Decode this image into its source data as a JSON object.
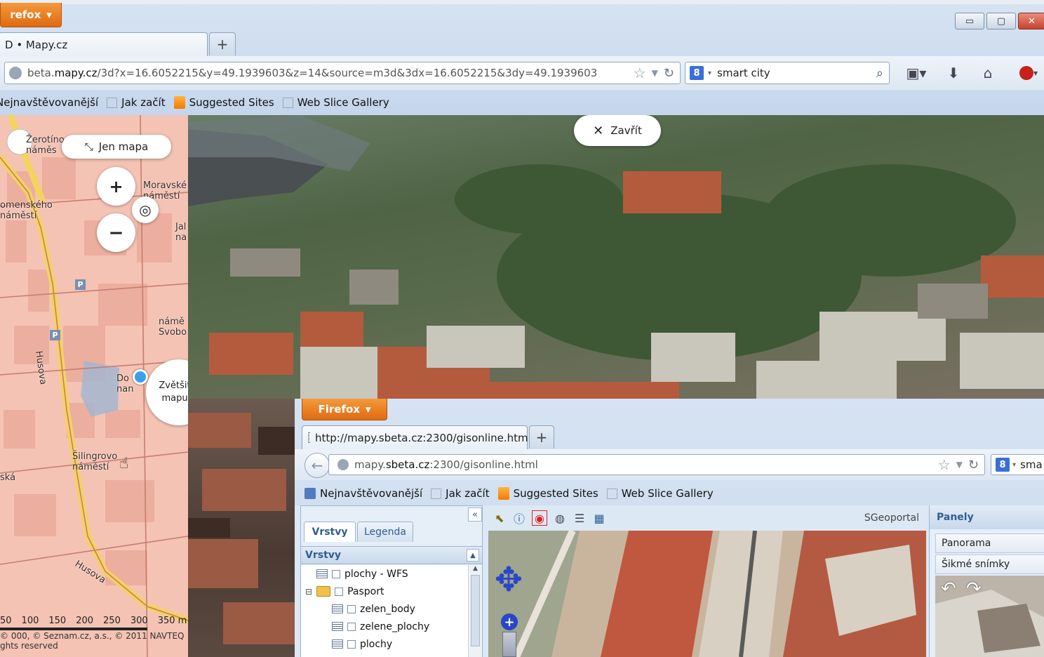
{
  "outer_browser": {
    "firefox_menu": "refox",
    "tab_title": "D • Mapy.cz",
    "new_tab": "+",
    "url": {
      "prefix": "beta.",
      "domain": "mapy.cz",
      "path": "/3d?x=16.6052215&y=49.1939603&z=14&source=m3d&3dx=16.6052215&3dy=49.1939603"
    },
    "search_value": "smart city",
    "search_engine_letter": "8",
    "bookmarks": [
      "Nejnavštěvovanější",
      "Jak začít",
      "Suggested Sites",
      "Web Slice Gallery"
    ],
    "window_buttons": {
      "minimize": "▭",
      "restore": "▢",
      "close": "✕"
    },
    "icons": [
      "page-icon",
      "star-icon",
      "dropdown-icon",
      "reload-icon",
      "search-icon",
      "bookmarks-icon",
      "download-icon",
      "home-icon",
      "adblock-icon"
    ]
  },
  "map2d": {
    "only_map_button": "Jen mapa",
    "zoom_in": "+",
    "zoom_out": "−",
    "expand_button": {
      "line1": "Zvětšit",
      "line2": "mapu"
    },
    "labels": {
      "zerotin": "Žerotíno",
      "namest1": "náměs",
      "moravske": "Moravské",
      "namesti_mor": "náměstí",
      "komenskeho": "omenského",
      "namesti_kom": "náměstí",
      "jal": "Jal",
      "na": "na",
      "namest_sv": "námě",
      "svobo": "Svobo",
      "husova1": "Husova",
      "husova2": "Husova",
      "silingrovo": "Šilingrovo",
      "namesti_sil": "náměstí",
      "ska": "ská",
      "dom": "Do",
      "nan": "nan"
    },
    "parking": "P",
    "scale_labels": [
      "50",
      "100",
      "150",
      "200",
      "250",
      "300",
      "350 m"
    ],
    "copyright": "© 000, © Seznam.cz, a.s., © 2011 NAVTEQ",
    "rights": "ghts reserved"
  },
  "view3d": {
    "close_button": "Zavřít"
  },
  "inner_browser": {
    "firefox_menu": "Firefox",
    "tab_title": "http://mapy.sbeta.cz:2300/gisonline.html",
    "new_tab": "+",
    "url": {
      "prefix": "mapy.",
      "domain": "sbeta.cz",
      "path": ":2300/gisonline.html"
    },
    "search_value": "sma",
    "bookmarks": [
      "Nejnavštěvovanější",
      "Jak začít",
      "Suggested Sites",
      "Web Slice Gallery"
    ],
    "collapse": "«",
    "tabs": [
      "Vrstvy",
      "Legenda"
    ],
    "layers_header": "Vrstvy",
    "layers": [
      {
        "name": "plochy - WFS",
        "indent": 0,
        "type": "layer"
      },
      {
        "name": "Pasport",
        "indent": 0,
        "type": "folder"
      },
      {
        "name": "zelen_body",
        "indent": 1,
        "type": "layer"
      },
      {
        "name": "zelene_plochy",
        "indent": 1,
        "type": "layer"
      },
      {
        "name": "plochy",
        "indent": 1,
        "type": "layer"
      }
    ],
    "tree_expander": "⊟",
    "map_title": "SGeoportal",
    "panels_header": "Panely",
    "panels": [
      "Panorama",
      "Šikmé snímky"
    ]
  },
  "colors": {
    "firefox_orange": "#e97a1c",
    "map_pink": "#f4c3b4",
    "road_yellow": "#f4d35e",
    "chrome_blue": "#d6e3f3",
    "panel_header": "#2f5d95"
  }
}
